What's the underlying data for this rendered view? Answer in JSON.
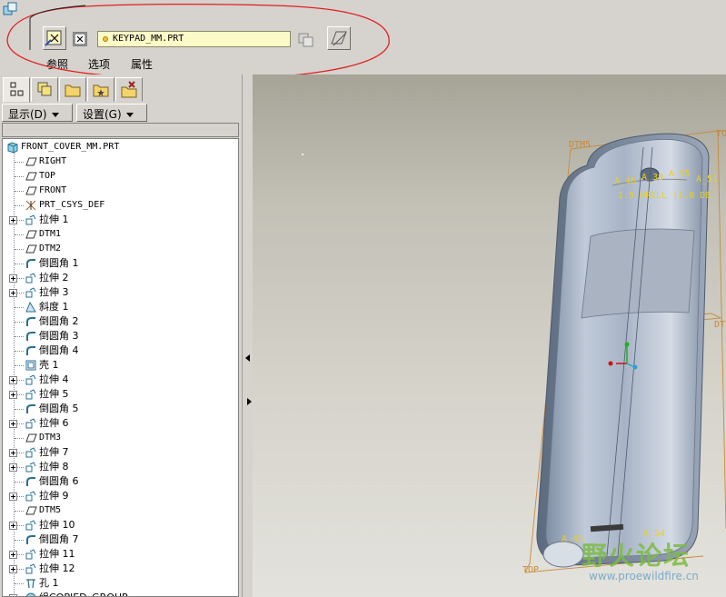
{
  "dashboard": {
    "reference_value": "KEYPAD_MM.PRT",
    "tabs": [
      "参照",
      "选项",
      "属性"
    ]
  },
  "navigator": {
    "tab_icons": [
      "model-tree-icon",
      "layers-icon",
      "folder-browser-icon",
      "favorites-icon",
      "connections-icon"
    ],
    "show_menu": "显示(D)",
    "settings_menu": "设置(G)"
  },
  "model_tree": {
    "root": "FRONT_COVER_MM.PRT",
    "items": [
      {
        "label": "RIGHT",
        "icon": "datum-plane-icon",
        "expandable": false
      },
      {
        "label": "TOP",
        "icon": "datum-plane-icon",
        "expandable": false
      },
      {
        "label": "FRONT",
        "icon": "datum-plane-icon",
        "expandable": false
      },
      {
        "label": "PRT_CSYS_DEF",
        "icon": "csys-icon",
        "expandable": false
      },
      {
        "label": "拉伸 1",
        "icon": "extrude-icon",
        "expandable": true
      },
      {
        "label": "DTM1",
        "icon": "datum-plane-icon",
        "expandable": false
      },
      {
        "label": "DTM2",
        "icon": "datum-plane-icon",
        "expandable": false
      },
      {
        "label": "倒圆角 1",
        "icon": "round-icon",
        "expandable": false
      },
      {
        "label": "拉伸 2",
        "icon": "extrude-icon",
        "expandable": true
      },
      {
        "label": "拉伸 3",
        "icon": "extrude-icon",
        "expandable": true
      },
      {
        "label": "斜度 1",
        "icon": "draft-icon",
        "expandable": false
      },
      {
        "label": "倒圆角 2",
        "icon": "round-icon",
        "expandable": false
      },
      {
        "label": "倒圆角 3",
        "icon": "round-icon",
        "expandable": false
      },
      {
        "label": "倒圆角 4",
        "icon": "round-icon",
        "expandable": false
      },
      {
        "label": "壳 1",
        "icon": "shell-icon",
        "expandable": false
      },
      {
        "label": "拉伸 4",
        "icon": "extrude-icon",
        "expandable": true
      },
      {
        "label": "拉伸 5",
        "icon": "extrude-icon",
        "expandable": true
      },
      {
        "label": "倒圆角 5",
        "icon": "round-icon",
        "expandable": false
      },
      {
        "label": "拉伸 6",
        "icon": "extrude-icon",
        "expandable": true
      },
      {
        "label": "DTM3",
        "icon": "datum-plane-icon",
        "expandable": false
      },
      {
        "label": "拉伸 7",
        "icon": "extrude-icon",
        "expandable": true
      },
      {
        "label": "拉伸 8",
        "icon": "extrude-icon",
        "expandable": true
      },
      {
        "label": "倒圆角 6",
        "icon": "round-icon",
        "expandable": false
      },
      {
        "label": "拉伸 9",
        "icon": "extrude-icon",
        "expandable": true
      },
      {
        "label": "DTM5",
        "icon": "datum-plane-icon",
        "expandable": false
      },
      {
        "label": "拉伸 10",
        "icon": "extrude-icon",
        "expandable": true
      },
      {
        "label": "倒圆角 7",
        "icon": "round-icon",
        "expandable": false
      },
      {
        "label": "拉伸 11",
        "icon": "extrude-icon",
        "expandable": true
      },
      {
        "label": "拉伸 12",
        "icon": "extrude-icon",
        "expandable": true
      },
      {
        "label": "孔 1",
        "icon": "hole-icon",
        "expandable": false
      },
      {
        "label": "组COPIED_GROUP",
        "icon": "group-icon",
        "expandable": true
      }
    ]
  },
  "viewport": {
    "datum_labels": [
      "DTM5",
      "TOP",
      "DT",
      "TOP"
    ],
    "dimension_labels": [
      "A_46",
      "A_38",
      "A_55",
      "A_51",
      "A_45",
      "A_54"
    ],
    "annotation": "1.5 DRILL (1.0 DE"
  },
  "watermark": {
    "text": "野火论坛",
    "url": "www.proewildfire.cn"
  },
  "colors": {
    "panel": "#d6d3ce",
    "reference_field": "#fbfbc8",
    "highlight_ellipse": "#e02020",
    "annotation": "#e8d020",
    "datum": "#c88a3a"
  }
}
